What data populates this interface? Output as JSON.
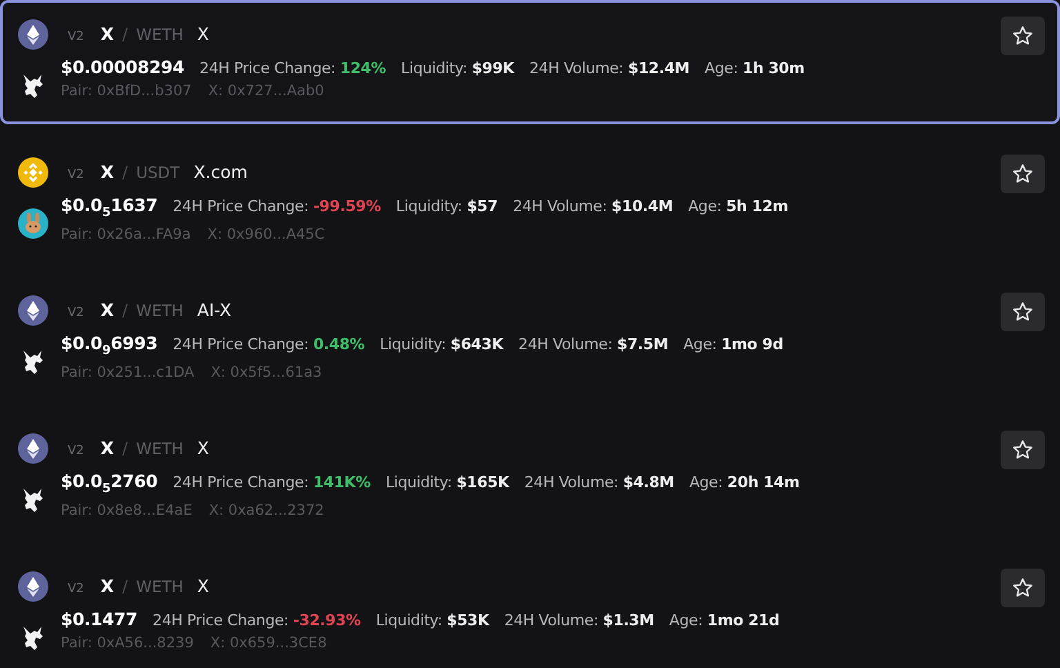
{
  "pairs": [
    {
      "selected": true,
      "icons": [
        {
          "kind": "ethereum"
        },
        {
          "kind": "unicorn"
        }
      ],
      "version": "V2",
      "base": "X",
      "separator": "/",
      "quote": "WETH",
      "name": "X",
      "price": "$0.00008294",
      "change_label": "24H Price Change:",
      "change": {
        "text": "124%",
        "color": "#3fbf6a"
      },
      "liquidity_label": "Liquidity:",
      "liquidity": "$99K",
      "volume_label": "24H Volume:",
      "volume": "$12.4M",
      "age_label": "Age:",
      "age": "1h 30m",
      "pair": "Pair: 0xBfD...b307",
      "token": "X: 0x727...Aab0"
    },
    {
      "selected": false,
      "icons": [
        {
          "kind": "bnb"
        },
        {
          "kind": "bunny"
        }
      ],
      "version": "V2",
      "base": "X",
      "separator": "/",
      "quote": "USDT",
      "name": "X.com",
      "price": "$0.0$_{5}$1637",
      "change_label": "24H Price Change:",
      "change": {
        "text": "-99.59%",
        "color": "#e04452"
      },
      "liquidity_label": "Liquidity:",
      "liquidity": "$57",
      "volume_label": "24H Volume:",
      "volume": "$10.4M",
      "age_label": "Age:",
      "age": "5h 12m",
      "pair": "Pair: 0x26a...FA9a",
      "token": "X: 0x960...A45C"
    },
    {
      "selected": false,
      "icons": [
        {
          "kind": "ethereum"
        },
        {
          "kind": "unicorn"
        }
      ],
      "version": "V2",
      "base": "X",
      "separator": "/",
      "quote": "WETH",
      "name": "AI-X",
      "price": "$0.0$_{9}$6993",
      "change_label": "24H Price Change:",
      "change": {
        "text": "0.48%",
        "color": "#3fbf6a"
      },
      "liquidity_label": "Liquidity:",
      "liquidity": "$643K",
      "volume_label": "24H Volume:",
      "volume": "$7.5M",
      "age_label": "Age:",
      "age": "1mo 9d",
      "pair": "Pair: 0x251...c1DA",
      "token": "X: 0x5f5...61a3"
    },
    {
      "selected": false,
      "icons": [
        {
          "kind": "ethereum"
        },
        {
          "kind": "unicorn"
        }
      ],
      "version": "V2",
      "base": "X",
      "separator": "/",
      "quote": "WETH",
      "name": "X",
      "price": "$0.0$_{5}$2760",
      "change_label": "24H Price Change:",
      "change": {
        "text": "141K%",
        "color": "#3fbf6a"
      },
      "liquidity_label": "Liquidity:",
      "liquidity": "$165K",
      "volume_label": "24H Volume:",
      "volume": "$4.8M",
      "age_label": "Age:",
      "age": "20h 14m",
      "pair": "Pair: 0x8e8...E4aE",
      "token": "X: 0xa62...2372"
    },
    {
      "selected": false,
      "icons": [
        {
          "kind": "ethereum"
        },
        {
          "kind": "unicorn"
        }
      ],
      "version": "V2",
      "base": "X",
      "separator": "/",
      "quote": "WETH",
      "name": "X",
      "price": "$0.1477",
      "change_label": "24H Price Change:",
      "change": {
        "text": "-32.93%",
        "color": "#e04452"
      },
      "liquidity_label": "Liquidity:",
      "liquidity": "$53K",
      "volume_label": "24H Volume:",
      "volume": "$1.3M",
      "age_label": "Age:",
      "age": "1mo 21d",
      "pair": "Pair: 0xA56...8239",
      "token": "X: 0x659...3CE8"
    }
  ]
}
